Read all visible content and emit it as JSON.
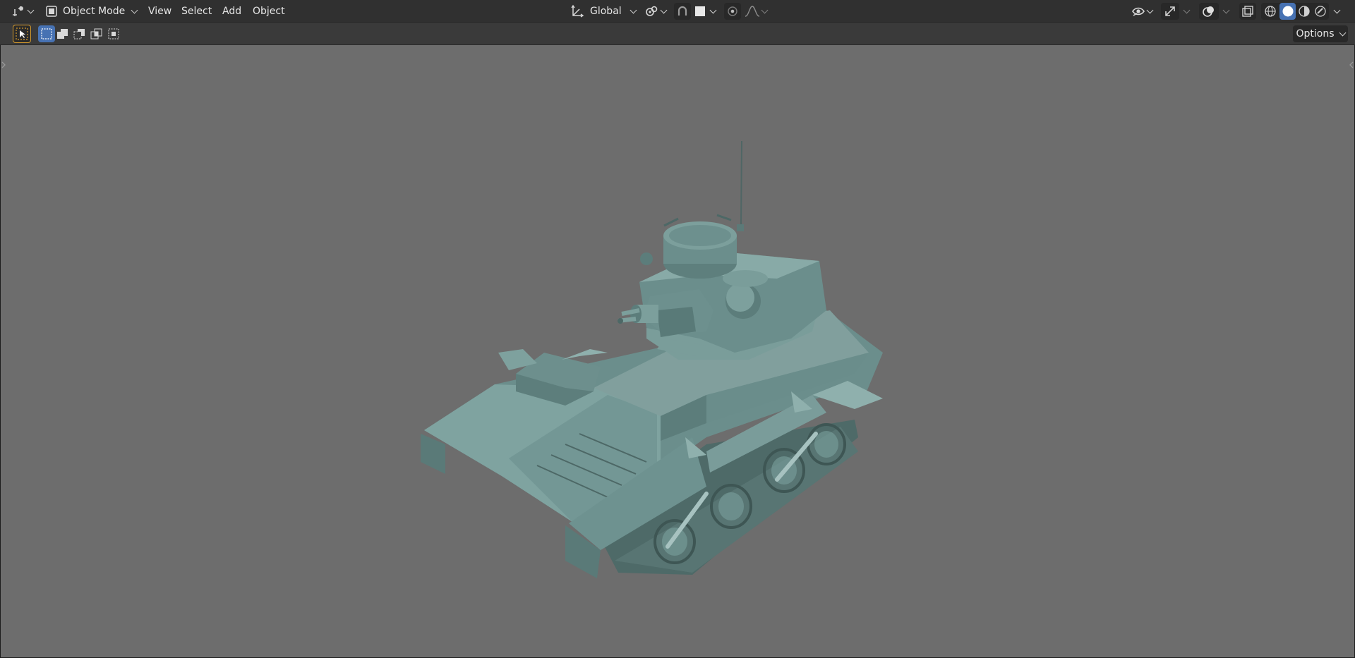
{
  "header": {
    "editor_type_icon": "object-mode-editor-icon",
    "mode_label": "Object Mode",
    "menus": [
      "View",
      "Select",
      "Add",
      "Object"
    ],
    "transform_orientation": "Global",
    "pivot_icon": "pivot-icon",
    "snap_icon": "snap-icon",
    "proportional_icon": "proportional-edit-icon",
    "falloff_icon": "falloff-icon",
    "visibility_icon": "eye-icon",
    "gizmo_icon": "gizmo-icon",
    "overlay_icon": "overlay-icon",
    "xray_icon": "xray-icon",
    "shading_modes": [
      "wireframe",
      "solid",
      "material",
      "rendered"
    ],
    "active_shading": "solid"
  },
  "toolbar": {
    "select_tool_icon": "select-box-icon",
    "select_modes": [
      "new",
      "extend",
      "subtract",
      "intersect",
      "invert"
    ],
    "options_label": "Options"
  },
  "colors": {
    "viewport_bg": "#6d6d6d",
    "header_bg": "#303030",
    "accent": "#4772b3",
    "tank_body": "#6b8e8c"
  },
  "viewport": {
    "object": "tank-model"
  }
}
